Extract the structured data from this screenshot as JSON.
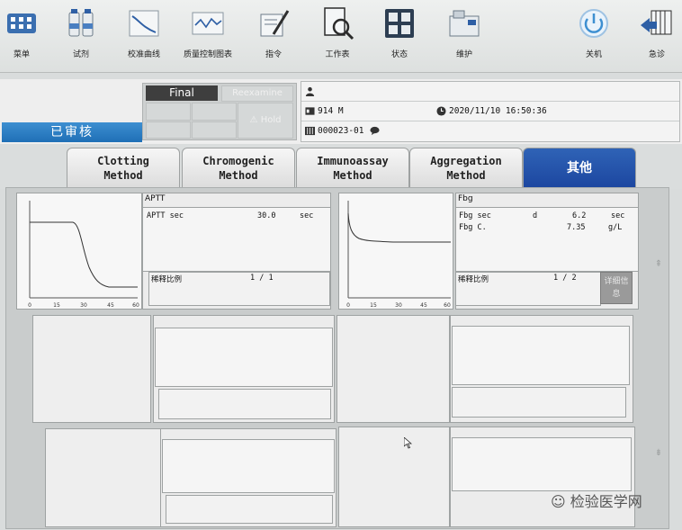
{
  "toolbar": {
    "items": [
      {
        "label": "菜单",
        "icon": "menu-grid-icon"
      },
      {
        "label": "试剂",
        "icon": "reagent-bottles-icon"
      },
      {
        "label": "校准曲线",
        "icon": "calibration-curve-icon"
      },
      {
        "label": "质量控制图表",
        "icon": "qc-chart-icon"
      },
      {
        "label": "指令",
        "icon": "instruction-pen-icon"
      },
      {
        "label": "工作表",
        "icon": "worksheet-magnifier-icon"
      },
      {
        "label": "状态",
        "icon": "status-panel-icon"
      },
      {
        "label": "维护",
        "icon": "maintenance-analyzer-icon"
      },
      {
        "label": "关机",
        "icon": "power-icon"
      },
      {
        "label": "急诊",
        "icon": "stat-rack-icon"
      }
    ]
  },
  "status": {
    "final": "Final",
    "rerun": "Reexamine",
    "hold": "Hold"
  },
  "audited": "已审核",
  "sample": {
    "info": "914 M",
    "datetime": "2020/11/10 16:50:36",
    "sample_id": "000023-01"
  },
  "tabs": [
    {
      "line1": "Clotting",
      "line2": "Method"
    },
    {
      "line1": "Chromogenic",
      "line2": "Method"
    },
    {
      "line1": "Immunoassay",
      "line2": "Method"
    },
    {
      "line1": "Aggregation",
      "line2": "Method"
    },
    {
      "line1": "其他",
      "line2": ""
    }
  ],
  "active_tab": "其他",
  "panels": [
    {
      "title": "APTT",
      "results": [
        {
          "name": "APTT sec",
          "flag": "",
          "value": "30.0",
          "unit": "sec"
        }
      ],
      "dilution_label": "稀释比例",
      "dilution": "1 / 1",
      "x_ticks": [
        "0",
        "15",
        "30",
        "45",
        "60"
      ]
    },
    {
      "title": "Fbg",
      "results": [
        {
          "name": "Fbg sec",
          "flag": "d",
          "value": "6.2",
          "unit": "sec"
        },
        {
          "name": "Fbg C.",
          "flag": "",
          "value": "7.35",
          "unit": "g/L"
        }
      ],
      "dilution_label": "稀释比例",
      "dilution": "1 / 2",
      "x_ticks": [
        "0",
        "15",
        "30",
        "45",
        "60"
      ]
    }
  ],
  "details_button": "详细信息",
  "watermark": "检验医学网",
  "colors": {
    "active_tab": "#1f4ea6",
    "audited_badge": "#2a7cc2",
    "final_badge": "#3e3e3e"
  }
}
